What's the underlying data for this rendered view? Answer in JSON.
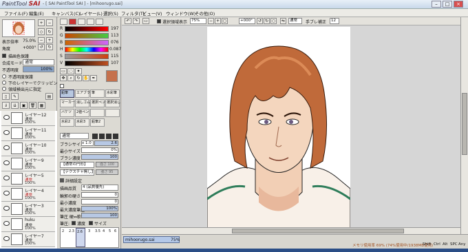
{
  "window": {
    "logo_word": "PaintTool",
    "logo_name": "SAI",
    "title": "- [ SAI PaintTool SAI ] - [mihoorugo.sai]"
  },
  "menu": [
    "ファイル(F)",
    "編集(E)",
    "キャンバス(C)",
    "レイヤー(L)",
    "選択(S)",
    "フィルタ(T)",
    "ビュー(V)",
    "ウィンドウ(W)",
    "その他(O)"
  ],
  "nav": {
    "zoom_label": "表示倍率",
    "zoom_value": "75.0%",
    "angle_label": "角度",
    "angle_value": "+000°"
  },
  "color": {
    "sliders": [
      {
        "label": "R",
        "value": "197",
        "color": "#d04040"
      },
      {
        "label": "G",
        "value": "113",
        "color": "#40b040"
      },
      {
        "label": "B",
        "value": "076",
        "color": "#4060d0"
      },
      {
        "label": "H",
        "value": "0.087",
        "color": "#c080c0"
      },
      {
        "label": "S",
        "value": "115",
        "color": "#c0a080"
      },
      {
        "label": "V",
        "value": "107",
        "color": "#a0a0a0"
      }
    ],
    "current": "#c5714c"
  },
  "layer_props": {
    "protect": "描画色保護",
    "mode_label": "合成モード",
    "mode_value": "通常",
    "opacity_label": "不透明度",
    "opacity_value": "100%",
    "options": [
      "不透明度保護",
      "下のレイヤーでクリッピング",
      "領域検出元に指定"
    ]
  },
  "layers": [
    {
      "name": "レイヤー12",
      "mode": "通常",
      "opacity": "100%"
    },
    {
      "name": "レイヤー11",
      "mode": "通常",
      "opacity": "100%"
    },
    {
      "name": "レイヤー10",
      "mode": "通常",
      "opacity": "100%"
    },
    {
      "name": "レイヤー9",
      "mode": "通常",
      "opacity": "100%"
    },
    {
      "name": "レイヤー5",
      "mode": "通常",
      "opacity": "100%"
    },
    {
      "name": "レイヤー4",
      "mode": "通常",
      "opacity": "100%"
    },
    {
      "name": "レイヤー3",
      "mode": "通常",
      "opacity": "100%"
    },
    {
      "name": "huku",
      "mode": "通常",
      "opacity": "100%"
    },
    {
      "name": "レイヤー7",
      "mode": "通常",
      "opacity": "100%"
    }
  ],
  "tools": [
    {
      "label": "鉛筆"
    },
    {
      "label": "エアブラシ"
    },
    {
      "label": "筆"
    },
    {
      "label": "水彩筆"
    },
    {
      "label": "マーカー"
    },
    {
      "label": "消しゴム"
    },
    {
      "label": "選択ペン"
    },
    {
      "label": "選択消し"
    },
    {
      "label": "バケツ"
    },
    {
      "label": "2値ペン"
    },
    {
      "label": ""
    },
    {
      "label": ""
    },
    {
      "label": "水彩2"
    },
    {
      "label": "水彩3"
    },
    {
      "label": "鉛筆2"
    },
    {
      "label": ""
    }
  ],
  "brush": {
    "mode": "通常",
    "size_label": "ブラシサイズ",
    "size_mult": "x 1.0",
    "size_value": "2.6",
    "min_label": "最小サイズ",
    "min_value": "0%",
    "density_label": "ブラシ濃度",
    "density_value": "100",
    "shape_label": "【通常の円形】",
    "shape_value": "強さ 100",
    "texture_label": "【テクスチャ無し】",
    "texture_value": "強さ 95",
    "detail_label": "詳細設定",
    "quality_label": "描画品質",
    "quality_value": "4 (品質優先)",
    "edge_label": "輪郭の硬さ",
    "edge_value": "0",
    "min_density_label": "最小濃度",
    "min_density_value": "0",
    "max_pressure_label": "最大濃度筆圧",
    "max_pressure_value": "100%",
    "pressure_label": "筆圧 硬⇔軟",
    "pressure_value": "100",
    "pressure2_label": "筆圧:",
    "pressure_density": "濃度",
    "pressure_size": "サイズ",
    "sizes": [
      "2",
      "2.3",
      "2.6",
      "3",
      "3.5",
      "4",
      "5",
      "6"
    ],
    "selected_size": "2.6"
  },
  "canvas_toolbar": {
    "select_display": "選択領域表示",
    "zoom": "75%",
    "rotate": "+000°",
    "mode": "通常",
    "stab_label": "手ブレ補正",
    "stab_value": "12"
  },
  "statusbar": {
    "doc_name": "mihoorugo.sai",
    "doc_zoom": "75%",
    "memory": "メモリ使用率 69% (74%使用中/1938MB使用)",
    "keys": [
      "Shift",
      "Ctrl",
      "Alt",
      "SPC",
      "Any"
    ]
  }
}
